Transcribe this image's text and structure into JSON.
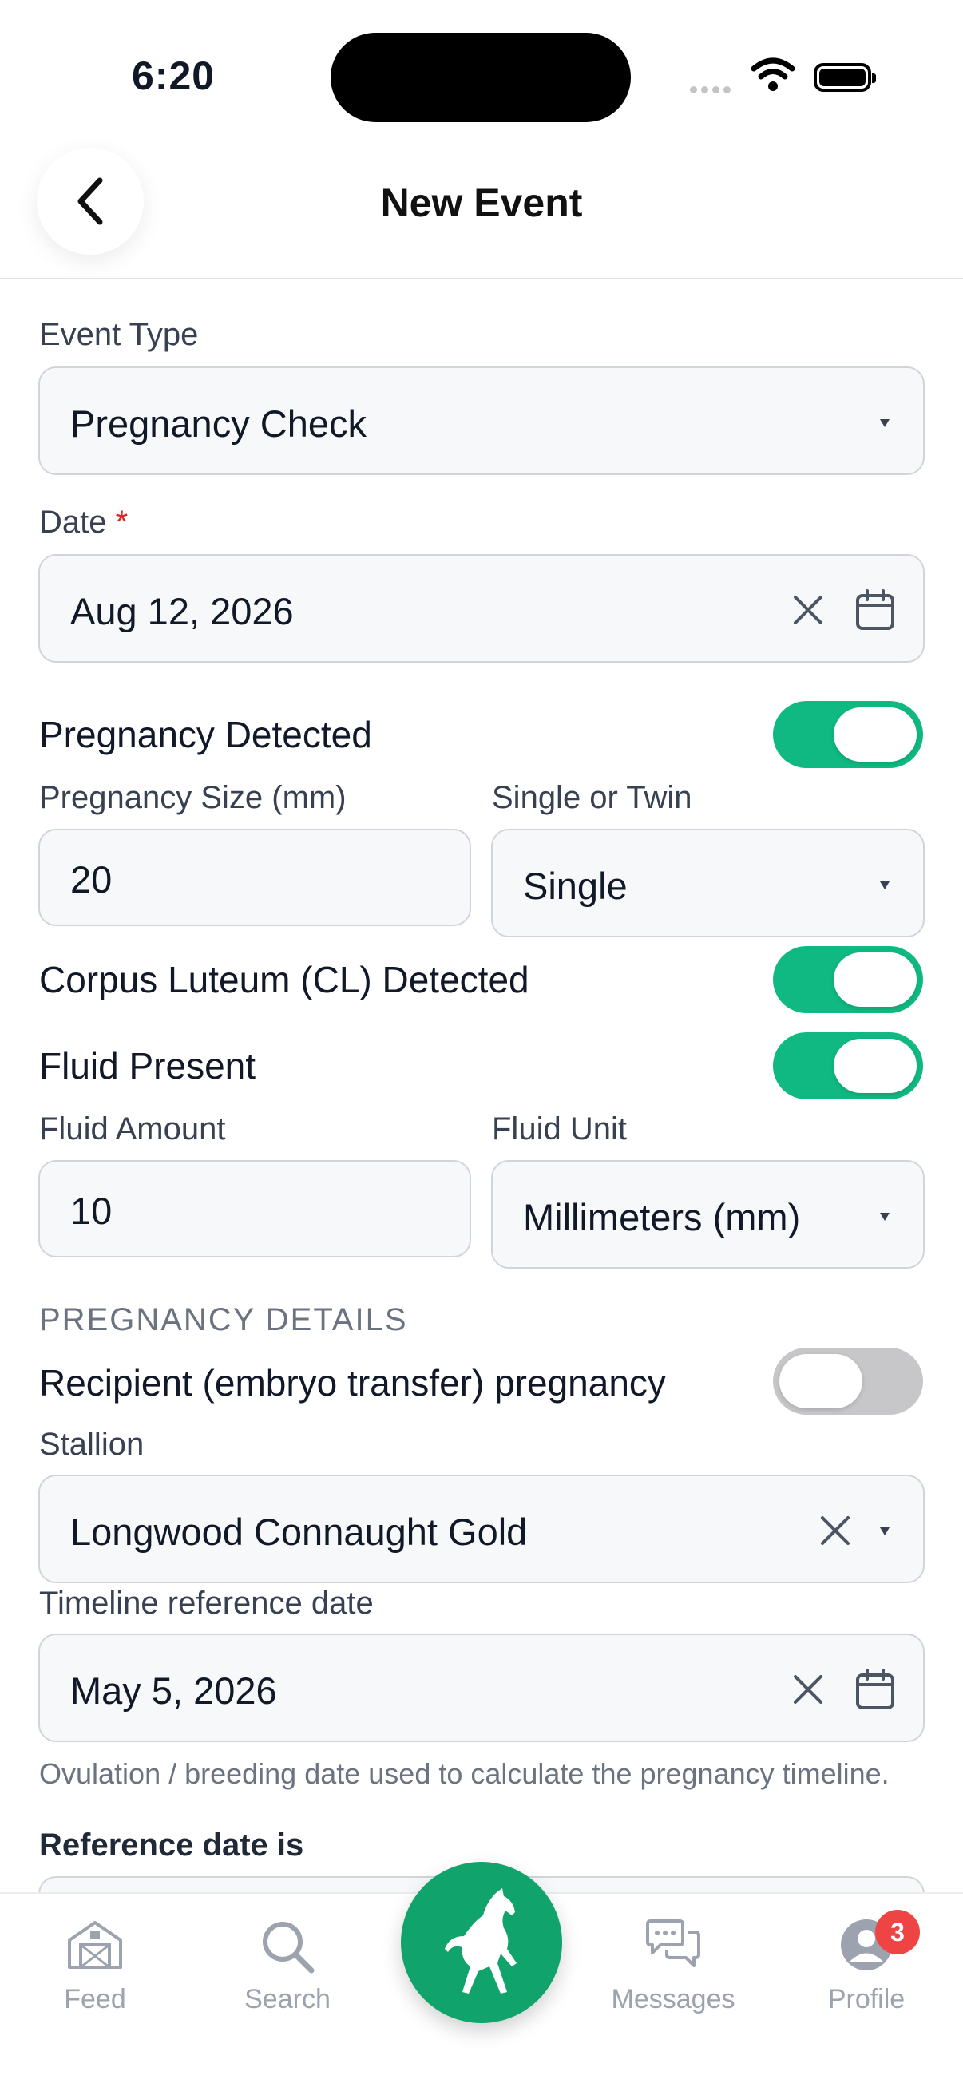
{
  "status_bar": {
    "time": "6:20"
  },
  "header": {
    "title": "New Event"
  },
  "form": {
    "event_type": {
      "label": "Event Type",
      "value": "Pregnancy Check"
    },
    "date": {
      "label": "Date",
      "required_mark": "*",
      "value": "Aug 12, 2026"
    },
    "pregnancy_detected": {
      "label": "Pregnancy Detected",
      "on": true
    },
    "pregnancy_size": {
      "label": "Pregnancy Size (mm)",
      "value": "20"
    },
    "single_or_twin": {
      "label": "Single or Twin",
      "value": "Single"
    },
    "cl_detected": {
      "label": "Corpus Luteum (CL) Detected",
      "on": true
    },
    "fluid_present": {
      "label": "Fluid Present",
      "on": true
    },
    "fluid_amount": {
      "label": "Fluid Amount",
      "value": "10"
    },
    "fluid_unit": {
      "label": "Fluid Unit",
      "value": "Millimeters (mm)"
    },
    "section_heading": "PREGNANCY DETAILS",
    "recipient_pregnancy": {
      "label": "Recipient (embryo transfer) pregnancy",
      "on": false
    },
    "stallion": {
      "label": "Stallion",
      "value": "Longwood Connaught Gold"
    },
    "timeline_reference_date": {
      "label": "Timeline reference date",
      "value": "May 5, 2026",
      "hint": "Ovulation / breeding date used to calculate the pregnancy timeline."
    },
    "reference_date_is": {
      "label": "Reference date is"
    }
  },
  "tabbar": {
    "items": [
      {
        "label": "Feed",
        "icon": "barn-icon"
      },
      {
        "label": "Search",
        "icon": "search-icon"
      },
      {
        "label": "",
        "icon": "horse-icon"
      },
      {
        "label": "Messages",
        "icon": "chat-bubbles-icon"
      },
      {
        "label": "Profile",
        "icon": "user-avatar-icon"
      }
    ],
    "profile_badge": "3"
  },
  "colors": {
    "accent": "#10b981",
    "fab": "#10a36b",
    "badge": "#ef4444",
    "required": "#dc2626"
  }
}
